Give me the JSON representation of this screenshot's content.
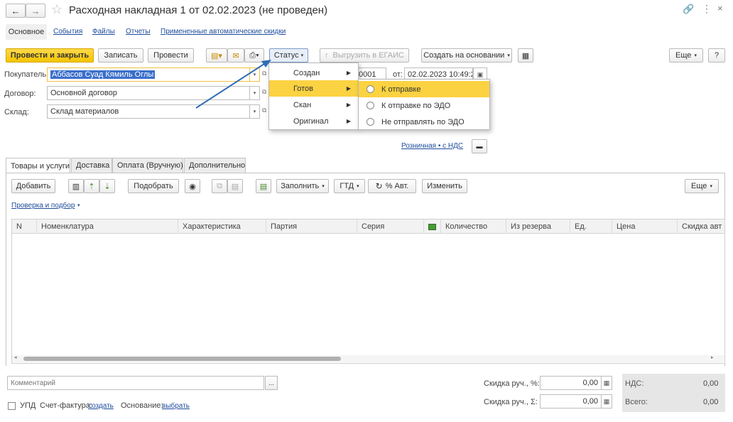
{
  "window": {
    "title": "Расходная накладная 1 от 02.02.2023 (не проведен)",
    "back_icon": "arrow-left",
    "forward_icon": "arrow-right",
    "star_icon": "star-outline",
    "link_icon": "chain-link",
    "more_icon": "vertical-dots",
    "close_icon": "close-x"
  },
  "nav_tabs": [
    "Основное",
    "События",
    "Файлы",
    "Отчеты",
    "Примененные автоматические скидки"
  ],
  "toolbar": {
    "post_close": "Провести и закрыть",
    "save": "Записать",
    "post": "Провести",
    "status": "Статус",
    "egais": "Выгрузить в ЕГАИС",
    "create_based": "Создать на основании",
    "more": "Еще",
    "help": "?"
  },
  "form": {
    "customer_label": "Покупатель:",
    "customer_value": "Аббасов Суад Кямиль Оглы",
    "contract_label": "Договор:",
    "contract_value": "Основной договор",
    "warehouse_label": "Склад:",
    "warehouse_value": "Склад материалов",
    "number_value": "0001",
    "date_label": "от:",
    "date_value": "02.02.2023 10:49:29",
    "price_type": "Розничная • с НДС"
  },
  "status_menu": {
    "items": [
      "Создан",
      "Готов",
      "Скан",
      "Оригинал"
    ],
    "highlighted": "Готов"
  },
  "submenu": {
    "items": [
      "К отправке",
      "К отправке по ЭДО",
      "Не отправлять по ЭДО"
    ],
    "highlighted": "К отправке"
  },
  "content_tabs": [
    "Товары и услуги",
    "Доставка",
    "Оплата (Вручную)",
    "Дополнительно"
  ],
  "table_toolbar": {
    "add": "Добавить",
    "pick": "Подобрать",
    "fill": "Заполнить",
    "gtd": "ГТД",
    "auto_pct": "% Авт.",
    "change": "Изменить",
    "more": "Еще",
    "check_link": "Проверка и подбор"
  },
  "table_columns": [
    "N",
    "Номенклатура",
    "Характеристика",
    "Партия",
    "Серия",
    "Количество",
    "Из резерва",
    "Ед.",
    "Цена",
    "Скидка авт"
  ],
  "footer": {
    "comment_placeholder": "Комментарий",
    "upd_label": "УПД",
    "invoice_label": "Счет-фактура:",
    "invoice_link": "создать",
    "basis_label": "Основание:",
    "basis_link": "выбрать",
    "manual_discount_pct_label": "Скидка руч., %:",
    "manual_discount_pct_value": "0,00",
    "manual_discount_sum_label": "Скидка руч., Σ:",
    "manual_discount_sum_value": "0,00",
    "vat_label": "НДС:",
    "vat_value": "0,00",
    "total_label": "Всего:",
    "total_value": "0,00"
  },
  "colors": {
    "accent_yellow": "#f5c400",
    "menu_highlight": "#fbd241",
    "link": "#1e4c9c",
    "arrow": "#2f6db7"
  }
}
